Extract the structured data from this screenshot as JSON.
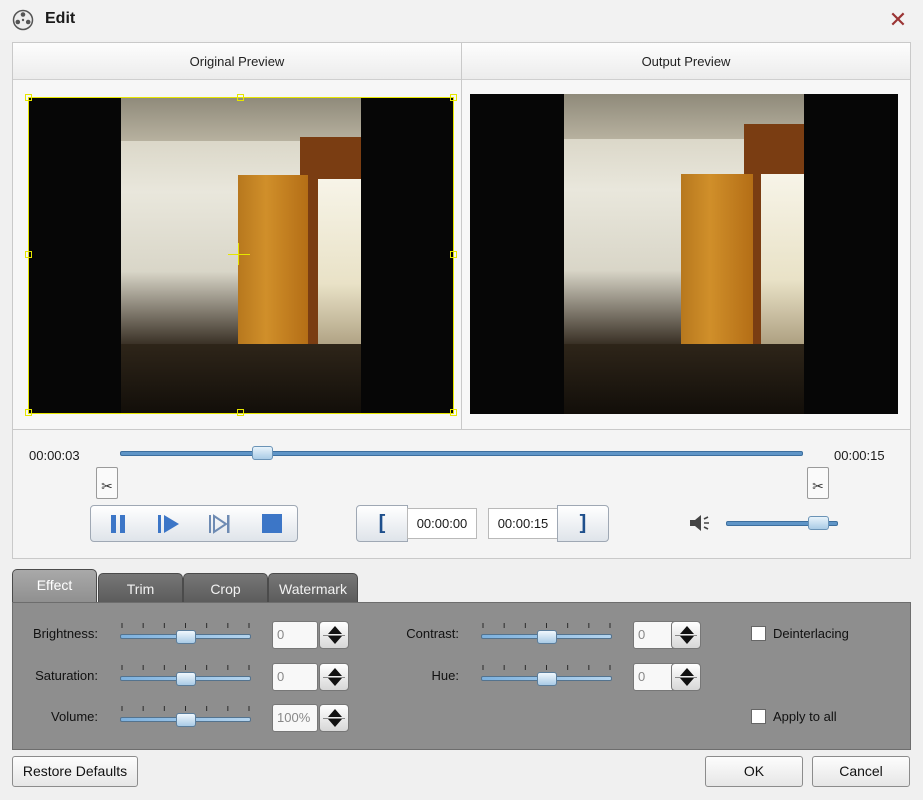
{
  "window": {
    "title": "Edit",
    "close_icon": "close-x"
  },
  "preview": {
    "original_label": "Original Preview",
    "output_label": "Output Preview"
  },
  "timeline": {
    "current_time": "00:00:03",
    "total_time": "00:00:15",
    "position_fraction": 0.2
  },
  "playback": {
    "icons": [
      "pause-icon",
      "play-icon",
      "next-frame-icon",
      "stop-icon"
    ]
  },
  "trim_controls": {
    "start_bracket": "[",
    "start_time": "00:00:00",
    "end_time": "00:00:15",
    "end_bracket": "]"
  },
  "volume": {
    "icon": "speaker-icon",
    "level_fraction": 0.9
  },
  "tabs": [
    {
      "label": "Effect",
      "active": true
    },
    {
      "label": "Trim",
      "active": false
    },
    {
      "label": "Crop",
      "active": false
    },
    {
      "label": "Watermark",
      "active": false
    }
  ],
  "effect": {
    "brightness_label": "Brightness:",
    "brightness_value": "0",
    "saturation_label": "Saturation:",
    "saturation_value": "0",
    "volume_label": "Volume:",
    "volume_value": "100%",
    "contrast_label": "Contrast:",
    "contrast_value": "0",
    "hue_label": "Hue:",
    "hue_value": "0",
    "deinterlacing_label": "Deinterlacing",
    "deinterlacing_checked": false,
    "apply_all_label": "Apply to all",
    "apply_all_checked": false
  },
  "footer": {
    "restore_label": "Restore Defaults",
    "ok_label": "OK",
    "cancel_label": "Cancel"
  },
  "colors": {
    "accent_blue": "#5f95c7",
    "selection_yellow": "#e6e600",
    "panel_gray": "#8e8e8e",
    "close_red": "#9b3434"
  }
}
